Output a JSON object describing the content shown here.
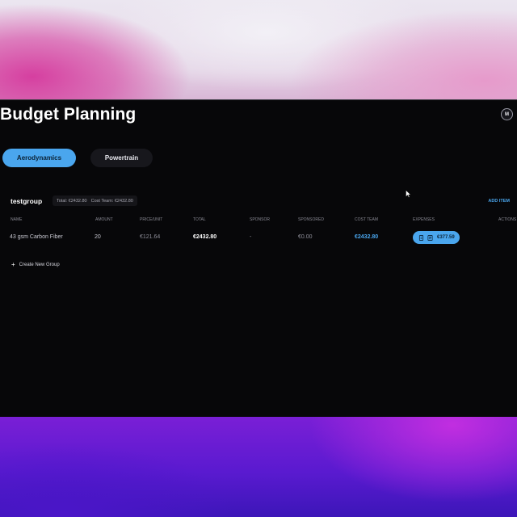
{
  "page": {
    "title": "Budget Planning",
    "avatar_initials": "M"
  },
  "tabs": [
    {
      "label": "Aerodynamics",
      "active": true
    },
    {
      "label": "Powertrain",
      "active": false
    }
  ],
  "group": {
    "name": "testgroup",
    "total": "Total: €2432.80",
    "cost_team": "Cost Team: €2432.80",
    "add_item_label": "ADD ITEM"
  },
  "table": {
    "columns": [
      "NAME",
      "AMOUNT",
      "PRICE/UNIT",
      "TOTAL",
      "SPONSOR",
      "SPONSORED",
      "COST TEAM",
      "EXPENSES",
      "ACTIONS"
    ],
    "rows": [
      {
        "name": "43 gsm Carbon Fiber",
        "amount": "20",
        "price_unit": "€121.64",
        "total": "€2432.80",
        "sponsor": "-",
        "sponsored": "€0.00",
        "cost_team": "€2432.80",
        "expenses": "€377.59"
      }
    ]
  },
  "create_group_label": "Create New Group",
  "colors": {
    "accent": "#4aa6ee",
    "background": "#070709"
  },
  "icons": {
    "plus": "plus-icon",
    "expense_a": "receipt-icon",
    "expense_b": "document-icon"
  }
}
